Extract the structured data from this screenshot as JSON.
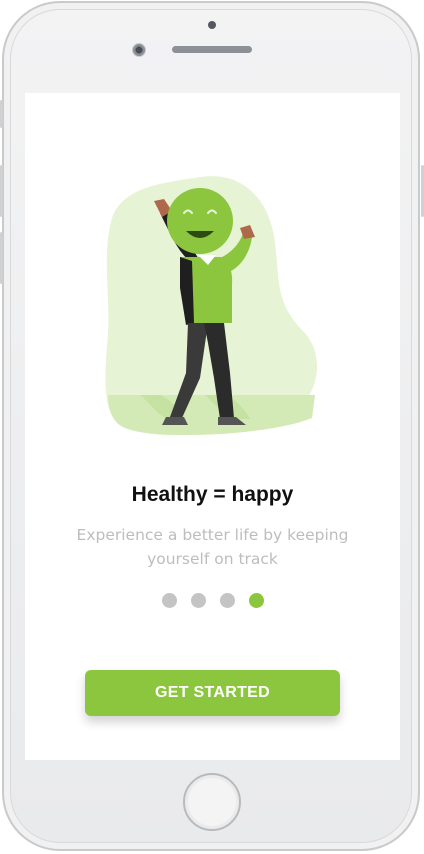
{
  "onboarding": {
    "title": "Healthy = happy",
    "subtitle": "Experience a better life by keeping yourself on track",
    "cta_label": "GET STARTED",
    "pages": 4,
    "active_page": 4
  },
  "icons": {
    "illustration": "person-with-smiley-face-illustration"
  },
  "colors": {
    "accent": "#8cc63e",
    "dot_inactive": "#c4c4c4",
    "blob": "#e6f3d4"
  }
}
